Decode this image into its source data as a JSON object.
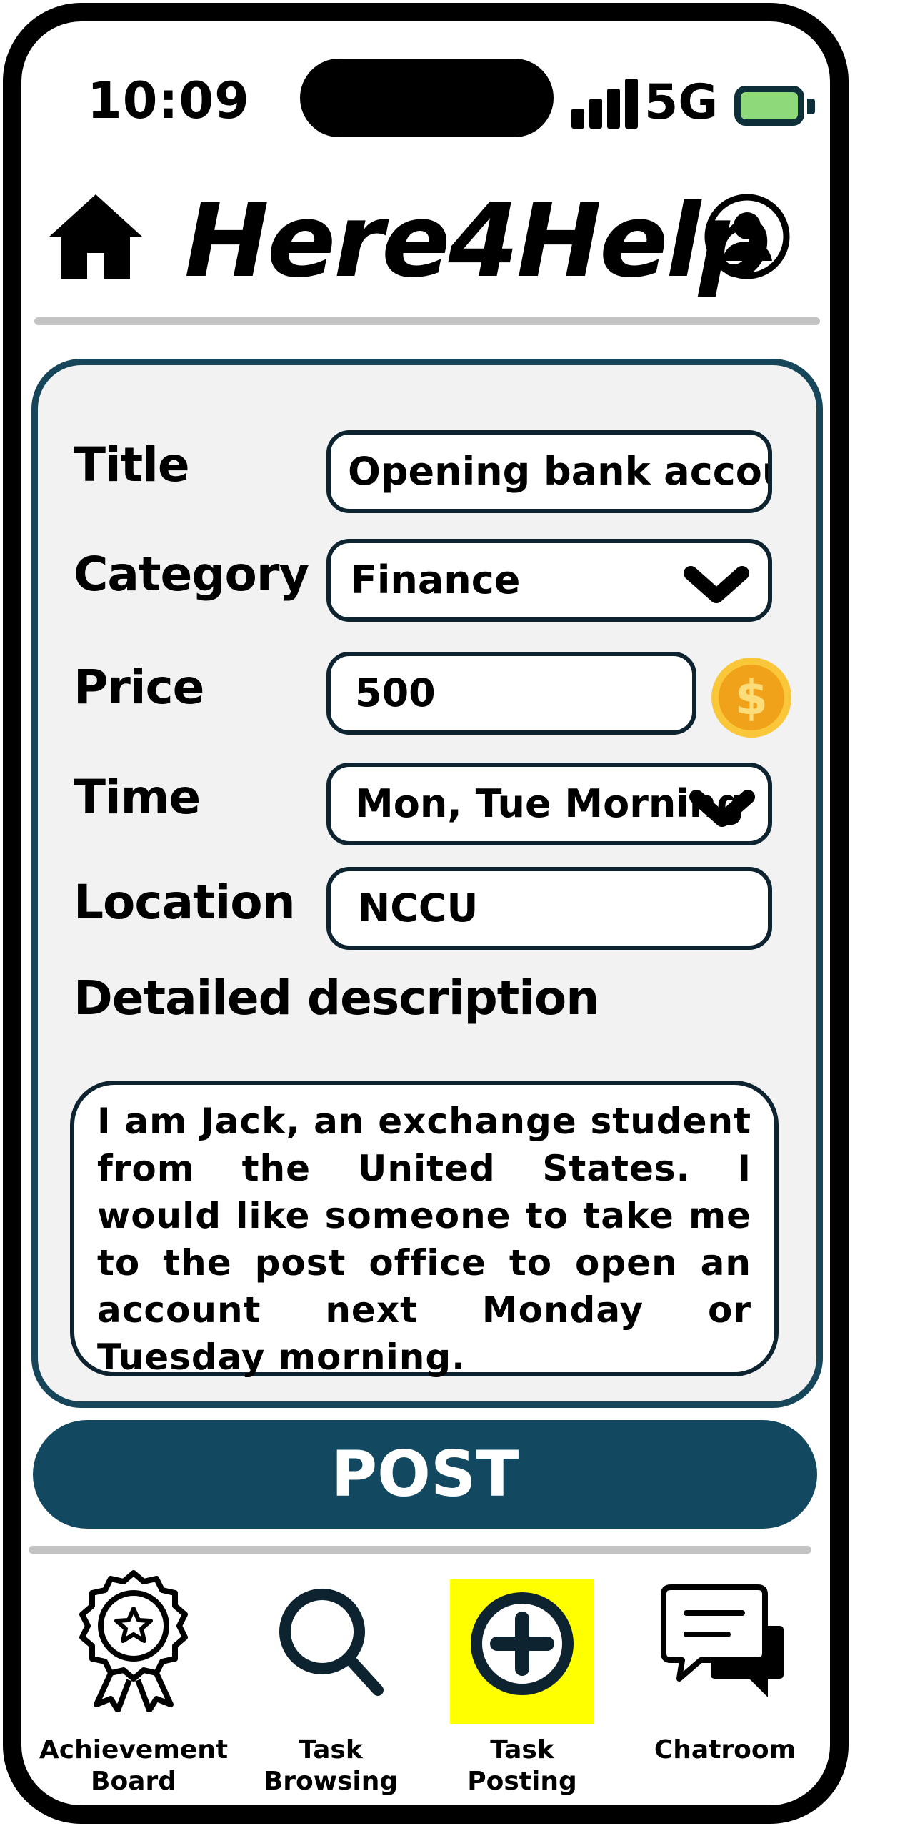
{
  "status_bar": {
    "time": "10:09",
    "network": "5G"
  },
  "header": {
    "app_title": "Here4Help"
  },
  "form": {
    "title_label": "Title",
    "title_value": "Opening bank account",
    "category_label": "Category",
    "category_value": "Finance",
    "price_label": "Price",
    "price_value": "500",
    "currency_symbol": "$",
    "time_label": "Time",
    "time_value": "Mon, Tue Morning",
    "location_label": "Location",
    "location_value": "NCCU",
    "description_label": "Detailed description",
    "description_value": "I am Jack, an exchange student from the United States. I would like someone to take me to the post office to open an account next Monday or Tuesday morning."
  },
  "post_button": "POST",
  "nav": [
    {
      "line1": "Achievement",
      "line2": "Board",
      "icon": "award-icon"
    },
    {
      "line1": "Task",
      "line2": "Browsing",
      "icon": "search-icon"
    },
    {
      "line1": "Task",
      "line2": "Posting",
      "icon": "plus-circle-icon",
      "active": true
    },
    {
      "line1": "Chatroom",
      "line2": "",
      "icon": "chat-icon"
    }
  ],
  "colors": {
    "accent": "#124960",
    "form_border": "#17465b",
    "battery": "#8ed97a",
    "coin": "#f0a21a",
    "active_tab_highlight": "#ffff00"
  }
}
